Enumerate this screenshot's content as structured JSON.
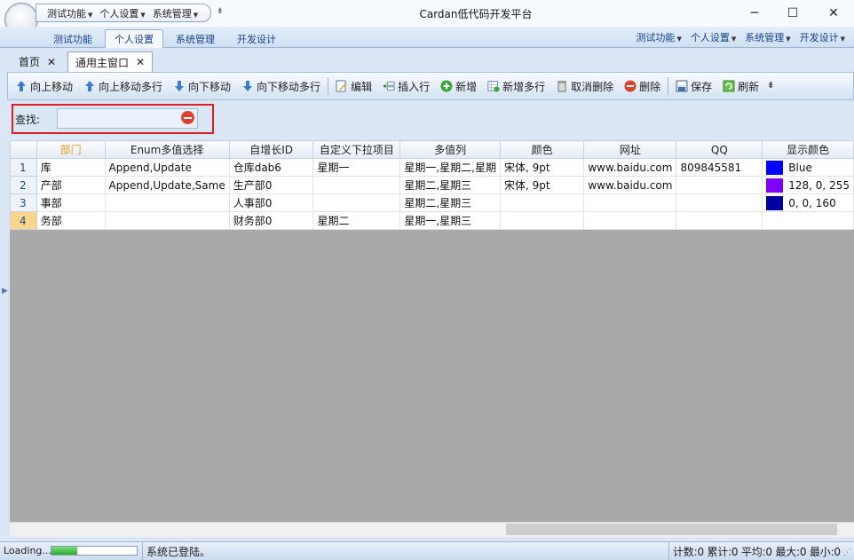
{
  "window": {
    "title": "Cardan低代码开发平台",
    "minimize": "─",
    "maximize": "☐",
    "close": "✕"
  },
  "quick_access": {
    "items": [
      "测试功能",
      "个人设置",
      "系统管理"
    ],
    "overflow": "⇟"
  },
  "ribbon_tabs": [
    "测试功能",
    "个人设置",
    "系统管理",
    "开发设计"
  ],
  "ribbon_active": "个人设置",
  "ribbon_menu": [
    "测试功能",
    "个人设置",
    "系统管理",
    "开发设计"
  ],
  "doc_tabs": [
    {
      "label": "首页",
      "close": "✕"
    },
    {
      "label": "通用主窗口",
      "close": "✕"
    }
  ],
  "toolbar": [
    {
      "label": "向上移动",
      "icon": "arrow-up-icon"
    },
    {
      "label": "向上移动多行",
      "icon": "arrow-up-multi-icon"
    },
    {
      "label": "向下移动",
      "icon": "arrow-down-icon"
    },
    {
      "label": "向下移动多行",
      "icon": "arrow-down-multi-icon"
    },
    {
      "label": "编辑",
      "icon": "edit-icon"
    },
    {
      "label": "插入行",
      "icon": "insert-row-icon"
    },
    {
      "label": "新增",
      "icon": "add-icon"
    },
    {
      "label": "新增多行",
      "icon": "add-multi-icon"
    },
    {
      "label": "取消删除",
      "icon": "undelete-icon"
    },
    {
      "label": "删除",
      "icon": "delete-icon"
    },
    {
      "label": "保存",
      "icon": "save-icon"
    },
    {
      "label": "刷新",
      "icon": "refresh-icon"
    }
  ],
  "search": {
    "label": "查找:",
    "value": "",
    "placeholder": ""
  },
  "grid": {
    "columns": [
      "",
      "部门",
      "Enum多值选择",
      "自增长ID",
      "自定义下拉项目",
      "多值列",
      "颜色",
      "网址",
      "QQ",
      "显示颜色"
    ],
    "rows": [
      {
        "num": "1",
        "dept": "库",
        "enum": "Append,Update",
        "id": "仓库dab6",
        "custom": "星期一",
        "multi": "星期一,星期二,星期",
        "color": "宋体, 9pt",
        "url": "www.baidu.com",
        "qq": "809845581",
        "swatch": "#0000ff",
        "display": "Blue"
      },
      {
        "num": "2",
        "dept": "产部",
        "enum": "Append,Update,Same",
        "id": "生产部0",
        "custom": "",
        "multi": "星期二,星期三",
        "color": "宋体, 9pt",
        "url": "www.baidu.com",
        "qq": "",
        "swatch": "#8000ff",
        "display": "128, 0, 255"
      },
      {
        "num": "3",
        "dept": "事部",
        "enum": "",
        "id": "人事部0",
        "custom": "",
        "multi": "星期二,星期三",
        "color": "",
        "url": "",
        "qq": "",
        "swatch": "#0000a0",
        "display": "0, 0, 160"
      },
      {
        "num": "4",
        "dept": "务部",
        "enum": "",
        "id": "财务部0",
        "custom": "星期二",
        "multi": "星期一,星期三",
        "color": "",
        "url": "",
        "qq": "",
        "swatch": "",
        "display": ""
      }
    ],
    "selected_row": "4"
  },
  "status": {
    "loading": "Loading...",
    "progress": 0.3,
    "message": "系统已登陆。",
    "stats": "计数:0 累计:0 平均:0 最大:0 最小:0"
  }
}
